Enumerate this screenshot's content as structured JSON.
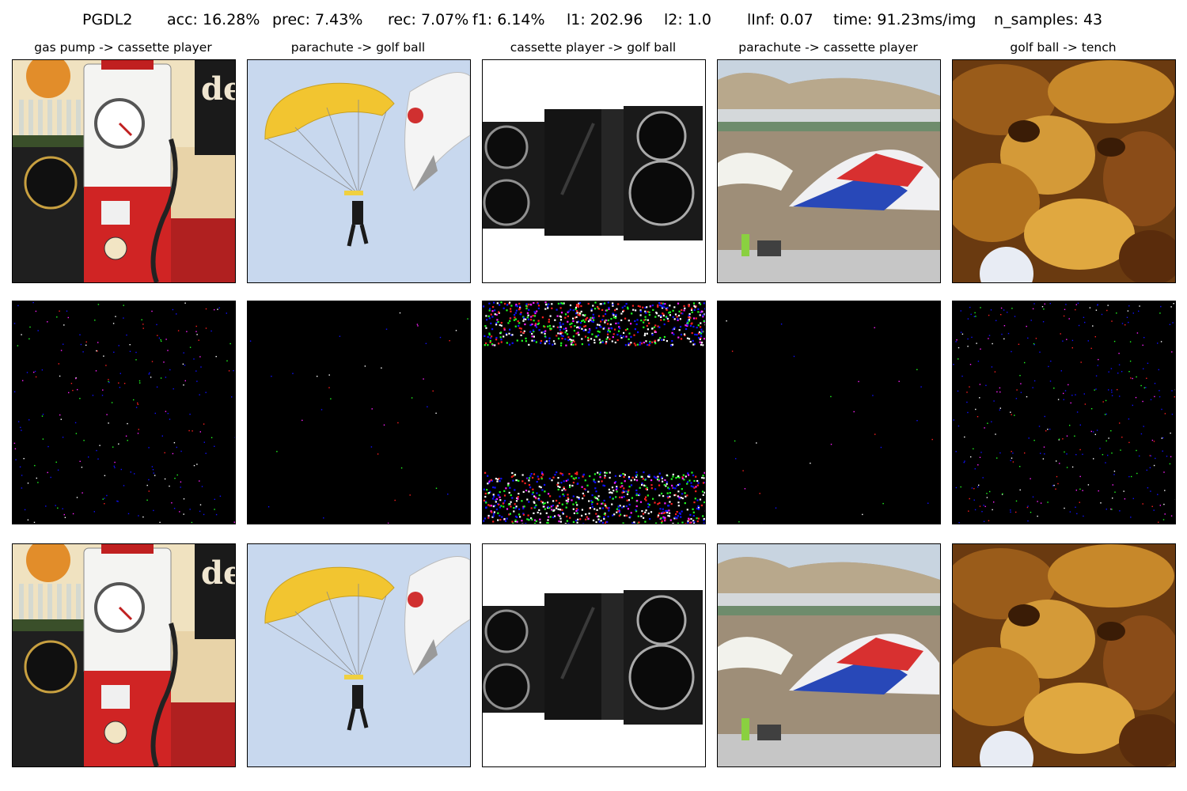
{
  "header": {
    "method": "PGDL2",
    "acc": "acc: 16.28%",
    "prec": "prec: 7.43%",
    "rec": "rec: 7.07%",
    "f1": "f1: 6.14%",
    "l1": "l1: 202.96",
    "l2": "l2: 1.0",
    "linf": "lInf: 0.07",
    "time": "time: 91.23ms/img",
    "n_samples": "n_samples: 43"
  },
  "columns": [
    {
      "title": "gas pump -> cassette player",
      "original": "gas-pump-photo",
      "adversarial": "gas-pump-photo"
    },
    {
      "title": "parachute -> golf ball",
      "original": "skydiver-parachute-photo",
      "adversarial": "skydiver-parachute-photo"
    },
    {
      "title": "cassette player -> golf ball",
      "original": "stereo-speakers-photo",
      "adversarial": "stereo-speakers-photo"
    },
    {
      "title": "parachute -> cassette player",
      "original": "airfield-parachutes-photo",
      "adversarial": "airfield-parachutes-photo"
    },
    {
      "title": "golf ball -> tench",
      "original": "autumn-leaves-golf-ball-photo",
      "adversarial": "autumn-leaves-golf-ball-photo"
    }
  ],
  "colors": {
    "noise_background": "#000000",
    "noise_blue": "#1010ff",
    "noise_red": "#ff2020",
    "noise_green": "#20ff20",
    "noise_white": "#ffffff",
    "noise_magenta": "#ff20ff"
  }
}
